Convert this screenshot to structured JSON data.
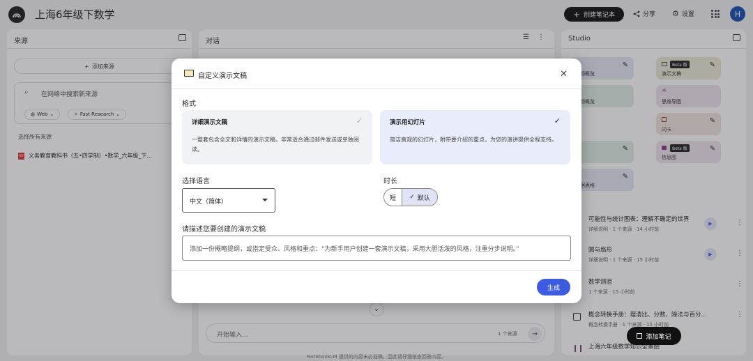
{
  "app": {
    "title": "上海6年级下数学",
    "create_label": "创建笔记本",
    "share_label": "分享",
    "settings_label": "设置",
    "avatar_letter": "H"
  },
  "sources": {
    "header": "来源",
    "add_label": "添加来源",
    "search_placeholder": "在网络中搜索新来源",
    "web_label": "Web",
    "research_label": "Fast Research",
    "select_all": "选择所有来源",
    "items": [
      {
        "icon": "pdf-icon",
        "title": "义务教育教科书（五•四学制）•数学_六年级_下..."
      }
    ]
  },
  "chat": {
    "header": "对话",
    "input_placeholder": "开始输入...",
    "source_count": "1 个来源",
    "footer_note": "NotebookLM 提供的内容未必准确，因此请仔细核查回答内容。"
  },
  "studio": {
    "header": "Studio",
    "tiles": [
      {
        "label": "频概览"
      },
      {
        "label": "演示文稿",
        "badge": "Beta 版"
      },
      {
        "label": "频概览"
      },
      {
        "label": "思维导图"
      },
      {
        "label": "闪卡"
      },
      {
        "label": "信息图",
        "badge": "Beta 版"
      },
      {
        "label": "据表格"
      }
    ],
    "items": [
      {
        "title": "可能性与统计图表：理解不确定的世界",
        "sub": "详细说明 · 1 个来源 · 14 小时前"
      },
      {
        "title": "圆与扇形",
        "sub": "详细说明 · 1 个来源 · 15 小时前"
      },
      {
        "title": "数学测验",
        "sub": "1 个来源 · 15 小时前"
      },
      {
        "title": "概念转换手册：理清比、分数、除法与百分...",
        "sub": "概念转换手册 · 1 个来源 · 15 小时前"
      },
      {
        "title": "上海六年级数学知识全景图",
        "sub": ""
      }
    ],
    "add_note_label": "添加笔记"
  },
  "modal": {
    "title": "自定义演示文稿",
    "format_label": "格式",
    "options": [
      {
        "title": "详细演示文稿",
        "desc": "一整套包含全文和详情的演示文稿，非常适合通过邮件发送或单独阅读。",
        "selected": false
      },
      {
        "title": "演示用幻灯片",
        "desc": "简洁直观的幻灯片，附带要介绍的重点，为您的演讲提供全程支持。",
        "selected": true
      }
    ],
    "language_label": "选择语言",
    "language_value": "中文（简体）",
    "duration_label": "时长",
    "duration_short": "短",
    "duration_default": "默认",
    "describe_label": "请描述您要创建的演示文稿",
    "describe_placeholder": "添加一份概略提纲，或指定受众、风格和重点：“为新手用户创建一套演示文稿，采用大胆活泼的风格，注重分步说明。”",
    "generate_label": "生成"
  },
  "colors": {
    "accent": "#3d5be0",
    "selected_card": "#e9ecfb",
    "scrim": "rgba(40,40,48,0.32)"
  }
}
